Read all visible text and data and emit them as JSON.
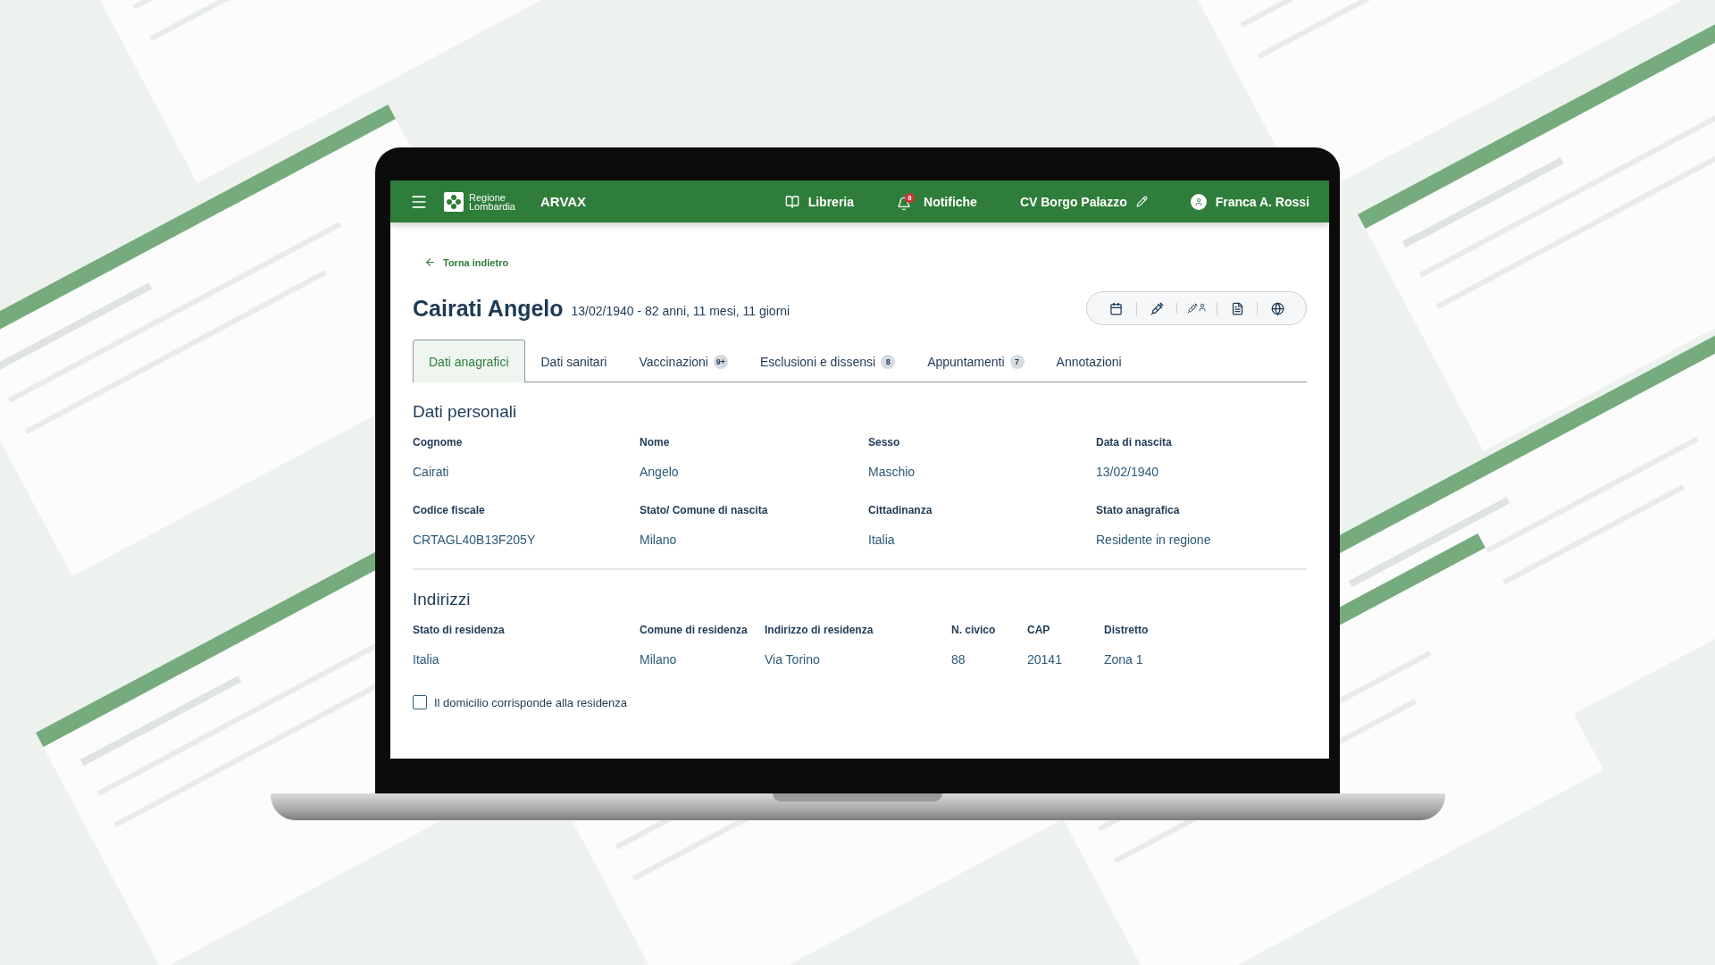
{
  "header": {
    "logo": [
      "Regione",
      "Lombardia"
    ],
    "app": "ARVAX",
    "nav": [
      {
        "kind": "library",
        "label": "Libreria"
      },
      {
        "kind": "notifications",
        "label": "Notifiche",
        "badge": "8"
      },
      {
        "kind": "site",
        "label": "CV Borgo Palazzo"
      },
      {
        "kind": "user",
        "label": "Franca A. Rossi"
      }
    ]
  },
  "back": "Torna indietro",
  "patient": {
    "name": "Cairati Angelo",
    "details": "13/02/1940 - 82 anni, 11 mesi, 11 giorni"
  },
  "tabs": [
    {
      "label": "Dati anagrafici",
      "selected": true
    },
    {
      "label": "Dati sanitari",
      "selected": false
    },
    {
      "label": "Vaccinazioni",
      "badge": "9+",
      "selected": false
    },
    {
      "label": "Esclusioni e dissensi",
      "badge": "8",
      "selected": false
    },
    {
      "label": "Appuntamenti",
      "badge": "7",
      "selected": false
    },
    {
      "label": "Annotazioni",
      "selected": false
    }
  ],
  "personal": {
    "title": "Dati personali",
    "fields": [
      {
        "label": "Cognome",
        "value": "Cairati"
      },
      {
        "label": "Nome",
        "value": "Angelo"
      },
      {
        "label": "Sesso",
        "value": "Maschio"
      },
      {
        "label": "Data di nascita",
        "value": "13/02/1940"
      },
      {
        "label": "Codice fiscale",
        "value": "CRTAGL40B13F205Y"
      },
      {
        "label": "Stato/ Comune di nascita",
        "value": "Milano"
      },
      {
        "label": "Cittadinanza",
        "value": "Italia"
      },
      {
        "label": "Stato anagrafica",
        "value": "Residente in regione"
      }
    ]
  },
  "addresses": {
    "title": "Indirizzi",
    "fields": [
      {
        "label": "Stato di residenza",
        "value": "Italia"
      },
      {
        "label": "Comune di residenza",
        "value": "Milano"
      },
      {
        "label": "Indirizzo di residenza",
        "value": "Via Torino"
      },
      {
        "label": "N. civico",
        "value": "88"
      },
      {
        "label": "CAP",
        "value": "20141"
      },
      {
        "label": "Distretto",
        "value": "Zona 1"
      }
    ],
    "checkbox": {
      "label": "Il domicilio corrisponde alla residenza",
      "checked": false
    }
  }
}
